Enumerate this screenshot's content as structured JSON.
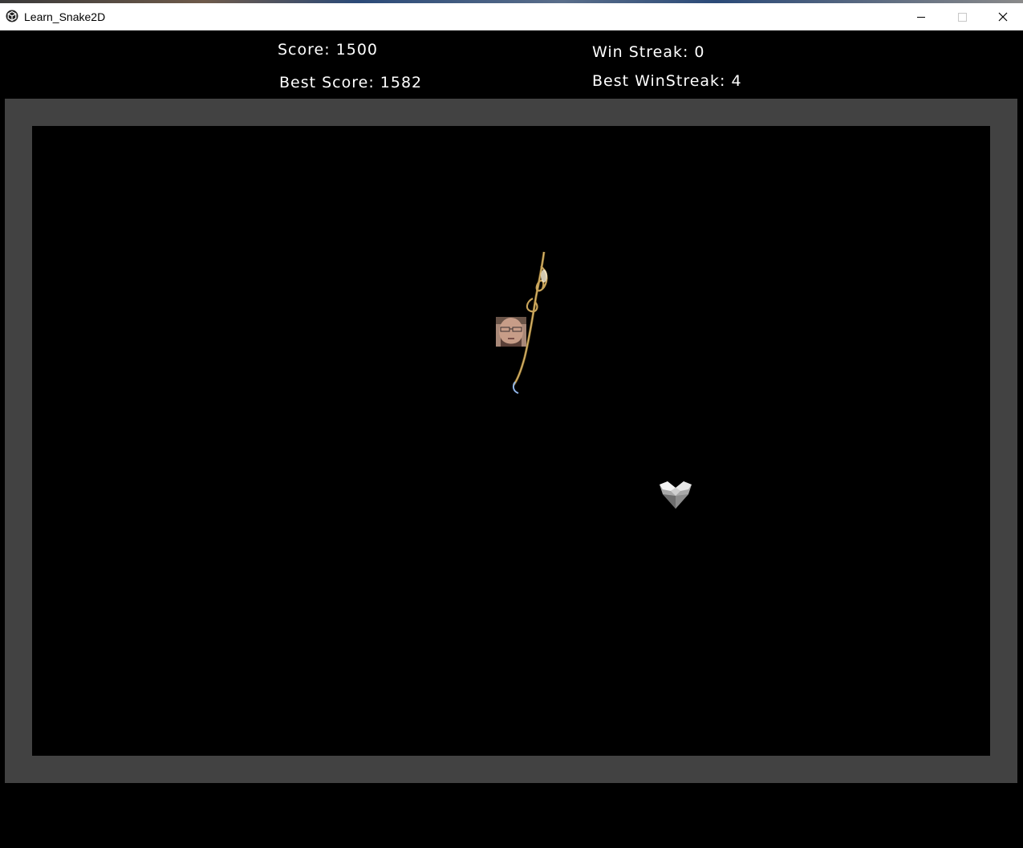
{
  "window": {
    "title": "Learn_Snake2D",
    "icon": "unity-icon",
    "controls": [
      "minimize-icon",
      "maximize-icon",
      "close-icon"
    ]
  },
  "hud": {
    "score": "Score: 1500",
    "best_score": "Best Score: 1582",
    "win_streak": "Win Streak: 0",
    "best_winstreak": "Best WinStreak: 4"
  },
  "colors": {
    "background": "#000000",
    "border": "#424242",
    "text": "#ffffff"
  },
  "sprites": {
    "snake_head": "face-icon",
    "snake_body": "rope-icon",
    "food": "gem-icon"
  }
}
